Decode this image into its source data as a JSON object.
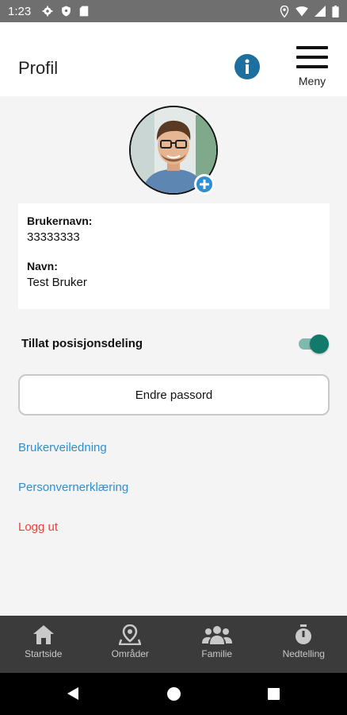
{
  "status_bar": {
    "time": "1:23",
    "icons_left": [
      "gear-icon",
      "shield-icon",
      "sd-card-icon"
    ],
    "icons_right": [
      "location-icon",
      "wifi-icon",
      "signal-icon",
      "battery-icon"
    ]
  },
  "header": {
    "title": "Profil",
    "info_icon": "info-icon",
    "menu_label": "Meny"
  },
  "profile": {
    "avatar_icon": "profile-photo",
    "add_photo_icon": "plus-circle-icon",
    "username_label": "Brukernavn:",
    "username_value": "33333333",
    "name_label": "Navn:",
    "name_value": "Test Bruker"
  },
  "settings": {
    "location_sharing_label": "Tillat posisjonsdeling",
    "location_sharing_enabled": true,
    "toggle_color": "#127a6a"
  },
  "actions": {
    "change_password_label": "Endre passord",
    "user_guide_label": "Brukerveiledning",
    "privacy_label": "Personvernerklæring",
    "logout_label": "Logg ut"
  },
  "colors": {
    "link_blue": "#2f8fd0",
    "logout_red": "#e0453a",
    "info_blue": "#1d6fa0",
    "tabbar_bg": "#3b3b3b"
  },
  "tabbar": {
    "items": [
      {
        "label": "Startside",
        "icon": "home-icon"
      },
      {
        "label": "Områder",
        "icon": "map-pin-icon"
      },
      {
        "label": "Familie",
        "icon": "family-icon"
      },
      {
        "label": "Nedtelling",
        "icon": "stopwatch-icon"
      }
    ]
  },
  "navbar": {
    "icons": [
      "back-icon",
      "home-circle-icon",
      "recents-icon"
    ]
  }
}
